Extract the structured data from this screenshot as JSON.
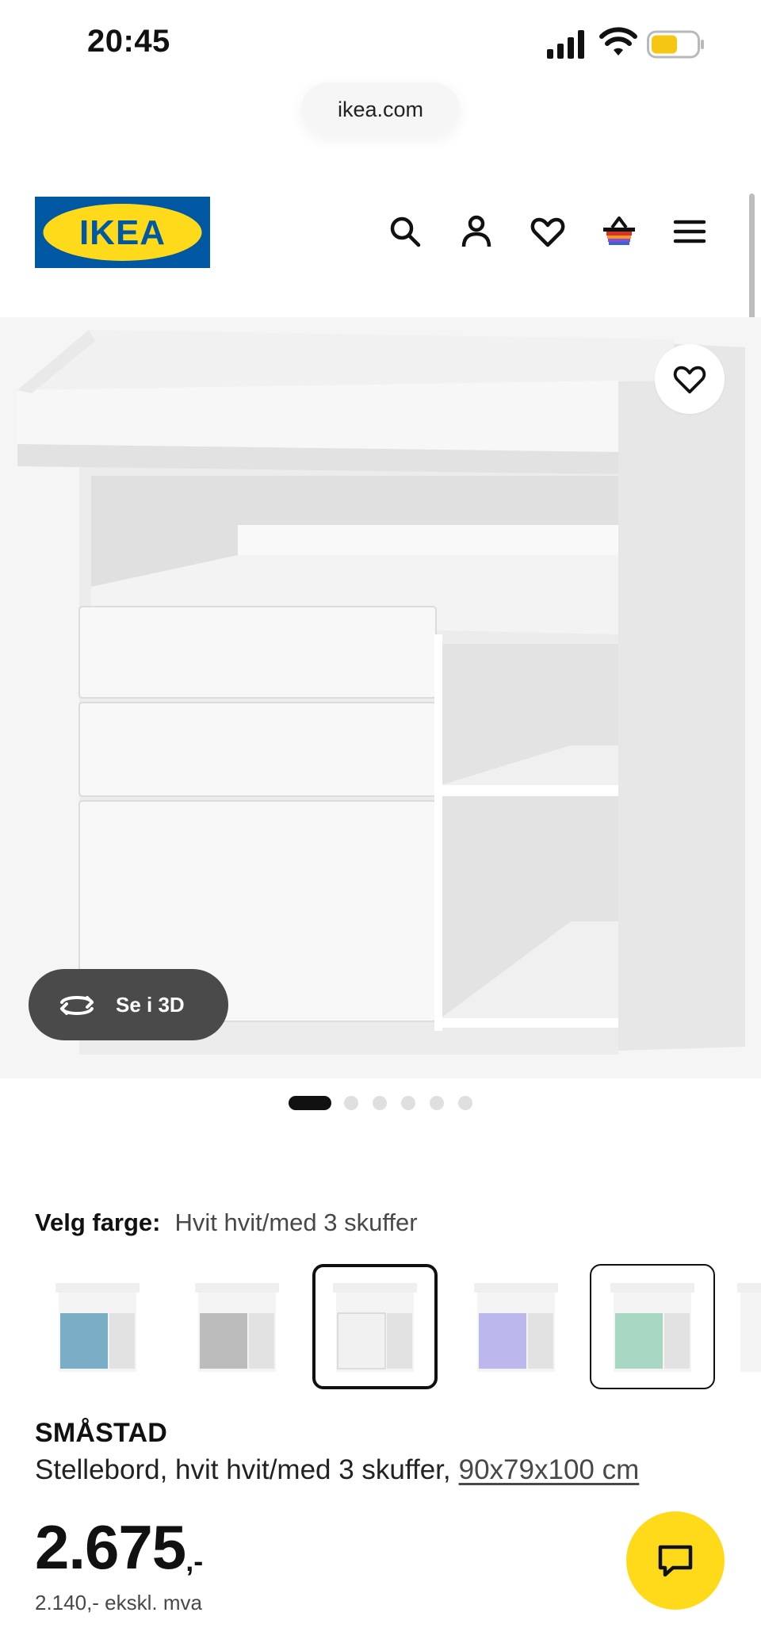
{
  "status_bar": {
    "time": "20:45",
    "icons": [
      "signal-icon",
      "wifi-icon",
      "battery-icon"
    ]
  },
  "browser": {
    "url": "ikea.com"
  },
  "header": {
    "logo_text": "IKEA",
    "icons": [
      "search-icon",
      "profile-icon",
      "heart-icon",
      "cart-icon",
      "menu-icon"
    ]
  },
  "product_image": {
    "view_3d_label": "Se i 3D",
    "image_count": 6,
    "active_image": 1
  },
  "color_picker": {
    "label": "Velg farge:",
    "selected_value": "Hvit hvit/med 3 skuffer",
    "swatches": [
      {
        "color": "#7aaec6"
      },
      {
        "color": "#bcbcbc"
      },
      {
        "color": "#f1f1f1"
      },
      {
        "color": "#bcb7ec"
      },
      {
        "color": "#a8d8c4"
      }
    ]
  },
  "product": {
    "name": "SMÅSTAD",
    "description": "Stellebord, hvit hvit/med 3 skuffer,",
    "dimensions": "90x79x100 cm",
    "price": "2.675",
    "price_suffix": ",-",
    "price_ex_vat": "2.140,- ekskl. mva"
  },
  "colors": {
    "brand_blue": "#0058a3",
    "brand_yellow": "#ffda1a",
    "text_dark": "#111111",
    "text_muted": "#484848"
  }
}
